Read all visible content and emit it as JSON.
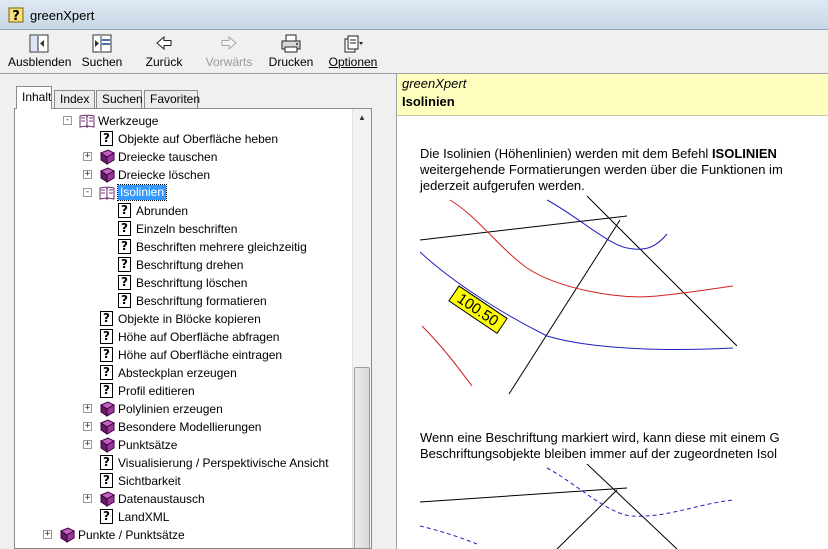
{
  "window": {
    "title": "greenXpert"
  },
  "toolbar": {
    "buttons": [
      {
        "label": "Ausblenden",
        "icon": "hide-icon",
        "enabled": true
      },
      {
        "label": "Suchen",
        "icon": "locate-icon",
        "enabled": true
      },
      {
        "label": "Zurück",
        "icon": "back-arrow-icon",
        "enabled": true
      },
      {
        "label": "Vorwärts",
        "icon": "forward-arrow-icon",
        "enabled": false
      },
      {
        "label": "Drucken",
        "icon": "printer-icon",
        "enabled": true
      },
      {
        "label": "Optionen",
        "icon": "options-icon",
        "enabled": true
      }
    ]
  },
  "tabs": [
    {
      "label": "Inhalt",
      "active": true
    },
    {
      "label": "Index",
      "active": false
    },
    {
      "label": "Suchen",
      "active": false
    },
    {
      "label": "Favoriten",
      "active": false
    }
  ],
  "tree": [
    {
      "label": "Werkzeuge",
      "level": 0,
      "type": "book-open",
      "expander": "-"
    },
    {
      "label": "Objekte auf Oberfläche heben",
      "level": 1,
      "type": "page"
    },
    {
      "label": "Dreiecke tauschen",
      "level": 1,
      "type": "book",
      "expander": "+"
    },
    {
      "label": "Dreiecke löschen",
      "level": 1,
      "type": "book",
      "expander": "+"
    },
    {
      "label": "Isolinien",
      "level": 1,
      "type": "book-open",
      "expander": "-",
      "selected": true
    },
    {
      "label": "Abrunden",
      "level": 2,
      "type": "page"
    },
    {
      "label": "Einzeln beschriften",
      "level": 2,
      "type": "page"
    },
    {
      "label": "Beschriften mehrere gleichzeitig",
      "level": 2,
      "type": "page"
    },
    {
      "label": "Beschriftung drehen",
      "level": 2,
      "type": "page"
    },
    {
      "label": "Beschriftung löschen",
      "level": 2,
      "type": "page"
    },
    {
      "label": "Beschriftung formatieren",
      "level": 2,
      "type": "page"
    },
    {
      "label": "Objekte in Blöcke kopieren",
      "level": 1,
      "type": "page"
    },
    {
      "label": "Höhe auf Oberfläche abfragen",
      "level": 1,
      "type": "page"
    },
    {
      "label": "Höhe auf Oberfläche eintragen",
      "level": 1,
      "type": "page"
    },
    {
      "label": "Absteckplan erzeugen",
      "level": 1,
      "type": "page"
    },
    {
      "label": "Profil editieren",
      "level": 1,
      "type": "page"
    },
    {
      "label": "Polylinien erzeugen",
      "level": 1,
      "type": "book",
      "expander": "+"
    },
    {
      "label": "Besondere Modellierungen",
      "level": 1,
      "type": "book",
      "expander": "+"
    },
    {
      "label": "Punktsätze",
      "level": 1,
      "type": "book",
      "expander": "+"
    },
    {
      "label": "Visualisierung / Perspektivische Ansicht",
      "level": 1,
      "type": "page"
    },
    {
      "label": "Sichtbarkeit",
      "level": 1,
      "type": "page"
    },
    {
      "label": "Datenaustausch",
      "level": 1,
      "type": "book",
      "expander": "+"
    },
    {
      "label": "LandXML",
      "level": 1,
      "type": "page"
    },
    {
      "label": "Punkte / Punktsätze",
      "level": -1,
      "type": "book",
      "expander": "+"
    }
  ],
  "content": {
    "app_name": "greenXpert",
    "topic_title": "Isolinien",
    "para1": {
      "line1_before": "Die Isolinien (Höhenlinien) werden mit dem Befehl ",
      "line1_bold": "ISOLINIEN",
      "line1_after": " ",
      "line2": "weitergehende Formatierungen werden über die Funktionen im",
      "line3": "jederzeit aufgerufen werden."
    },
    "figure1_label": "100.50",
    "para2": {
      "line1": "Wenn eine Beschriftung markiert wird, kann diese mit einem G",
      "line2": "Beschriftungsobjekte bleiben immer auf der zugeordneten Isol"
    }
  },
  "colors": {
    "header_bg": "#ffffc0",
    "selection": "#3399ff",
    "contour_red": "#d02020",
    "contour_blue": "#2020c0",
    "label_yellow": "#ffff00"
  }
}
